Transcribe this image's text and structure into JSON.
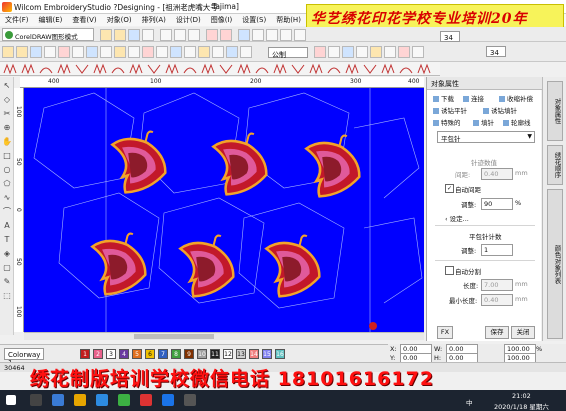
{
  "window": {
    "title": "Wilcom EmbroideryStudio ?Designing - [祖洲老虎嘴大号",
    "machine": "Tajima]"
  },
  "banner": {
    "text": "华艺绣花印花学校专业培训20年"
  },
  "menu": [
    "文件(F)",
    "编辑(E)",
    "查看(V)",
    "对象(O)",
    "排列(A)",
    "设计(D)",
    "图像(I)",
    "设置(S)",
    "帮助(H)"
  ],
  "toolbar": {
    "coreldraw_tab": "CorelDRAW图形模式",
    "font_field": "公制",
    "size_value_1": "34",
    "size_value_2": "34"
  },
  "ruler": {
    "h_ticks": [
      "400",
      "100",
      "200",
      "300",
      "400"
    ],
    "v_ticks": [
      "100",
      "50",
      "0",
      "50",
      "100"
    ]
  },
  "panel": {
    "title": "对象属性",
    "tabs": [
      "下载",
      "连接",
      "收缩补偿",
      "诱钻平针",
      "诱钻填针",
      "特殊的",
      "填针",
      "轮廓线"
    ],
    "stitch_type": "平包针",
    "section_spacing": "针迹数值",
    "spacing_label": "间距:",
    "spacing_value": "0.40",
    "unit_mm": "mm",
    "auto_spacing_label": "自动间距",
    "adjust_label": "调整:",
    "adjust_value": "90",
    "unit_pct": "%",
    "setting_label": "设定...",
    "section_satin": "平包针计数",
    "adjust2_label": "调整:",
    "adjust2_value": "1",
    "auto_split_label": "自动分割",
    "length_label": "长度:",
    "length_value": "7.00",
    "min_length_label": "最小长度:",
    "min_length_value": "0.40",
    "unit_mm2": "mm",
    "unit_mm3": "mm",
    "footer_left": "FX",
    "save_button": "保存",
    "close_button": "关闭"
  },
  "side_tabs": [
    "对象属性",
    "绣花顺序",
    "颜色对象列表"
  ],
  "colorbar": {
    "colorway": "Colorway 1",
    "swatches": [
      {
        "n": "1",
        "color": "#c01e1e"
      },
      {
        "n": "2",
        "color": "#e8608a"
      },
      {
        "n": "3",
        "color": "#ffffff"
      },
      {
        "n": "4",
        "color": "#6a3aa0"
      },
      {
        "n": "5",
        "color": "#e07020"
      },
      {
        "n": "6",
        "color": "#f0c000"
      },
      {
        "n": "7",
        "color": "#3060c0"
      },
      {
        "n": "8",
        "color": "#40a040"
      },
      {
        "n": "9",
        "color": "#803000"
      },
      {
        "n": "10",
        "color": "#a0a0a0"
      },
      {
        "n": "11",
        "color": "#202020"
      },
      {
        "n": "12",
        "color": "#ffffff"
      },
      {
        "n": "13",
        "color": "#d0d0d0"
      },
      {
        "n": "14",
        "color": "#f08080"
      },
      {
        "n": "15",
        "color": "#8080f0"
      },
      {
        "n": "16",
        "color": "#60c0c0"
      }
    ]
  },
  "coords": {
    "x_label": "X:",
    "x_value": "0.00",
    "w_label": "W:",
    "w_value": "0.00",
    "y_label": "Y:",
    "y_value": "0.00",
    "h_label": "H:",
    "h_value": "0.00",
    "w_pct": "100.00",
    "h_pct": "100.00",
    "pct": "%"
  },
  "status": {
    "count": "30464"
  },
  "promo": {
    "text": "绣花制版培训学校微信电话 18101616172"
  },
  "taskbar": {
    "time": "21:02",
    "date": "2020/1/18 星期六",
    "ime": "中"
  }
}
